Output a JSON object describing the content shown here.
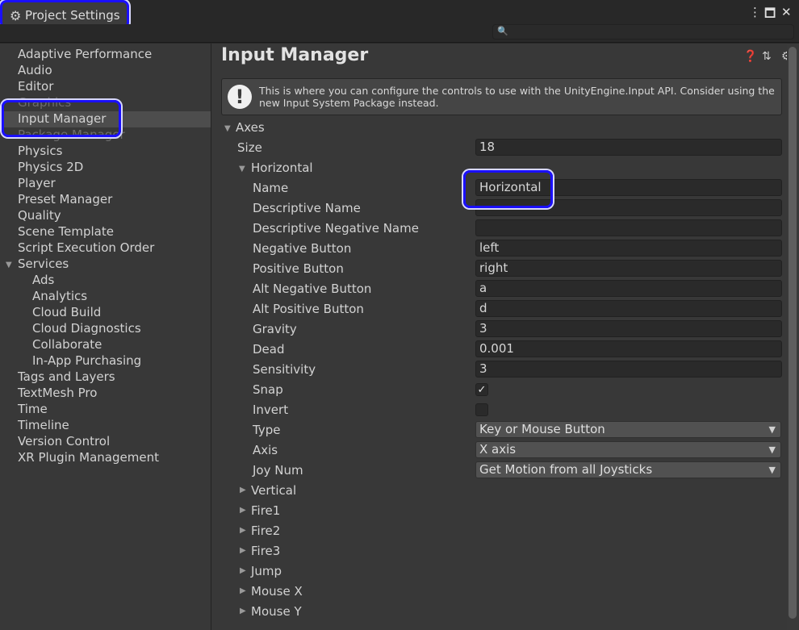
{
  "window": {
    "title": "Project Settings",
    "icons": {
      "tab": "gear-icon",
      "more": "kebab-menu-icon",
      "maximize": "maximize-icon",
      "close": "close-icon"
    }
  },
  "search": {
    "placeholder": "",
    "icon": "search-icon"
  },
  "sidebar": {
    "items": [
      "Adaptive Performance",
      "Audio",
      "Editor",
      "Graphics",
      "Input Manager",
      "Package Manager",
      "Physics",
      "Physics 2D",
      "Player",
      "Preset Manager",
      "Quality",
      "Scene Template",
      "Script Execution Order",
      "Services",
      "Ads",
      "Analytics",
      "Cloud Build",
      "Cloud Diagnostics",
      "Collaborate",
      "In-App Purchasing",
      "Tags and Layers",
      "TextMesh Pro",
      "Time",
      "Timeline",
      "Version Control",
      "XR Plugin Management"
    ],
    "selected": "Input Manager"
  },
  "main": {
    "title": "Input Manager",
    "info": "This is where you can configure the controls to use with the UnityEngine.Input API. Consider using the new Input System Package instead.",
    "axes_label": "Axes",
    "size_label": "Size",
    "size_value": "18",
    "horizontal": {
      "label": "Horizontal",
      "fields": [
        {
          "label": "Name",
          "value": "Horizontal"
        },
        {
          "label": "Descriptive Name",
          "value": ""
        },
        {
          "label": "Descriptive Negative Name",
          "value": ""
        },
        {
          "label": "Negative Button",
          "value": "left"
        },
        {
          "label": "Positive Button",
          "value": "right"
        },
        {
          "label": "Alt Negative Button",
          "value": "a"
        },
        {
          "label": "Alt Positive Button",
          "value": "d"
        },
        {
          "label": "Gravity",
          "value": "3"
        },
        {
          "label": "Dead",
          "value": "0.001"
        },
        {
          "label": "Sensitivity",
          "value": "3"
        }
      ],
      "snap_label": "Snap",
      "snap_checked": true,
      "invert_label": "Invert",
      "invert_checked": false,
      "type_label": "Type",
      "type_value": "Key or Mouse Button",
      "axis_label": "Axis",
      "axis_value": "X axis",
      "joy_label": "Joy Num",
      "joy_value": "Get Motion from all Joysticks"
    },
    "collapsed_axes": [
      "Vertical",
      "Fire1",
      "Fire2",
      "Fire3",
      "Jump",
      "Mouse X",
      "Mouse Y"
    ]
  }
}
